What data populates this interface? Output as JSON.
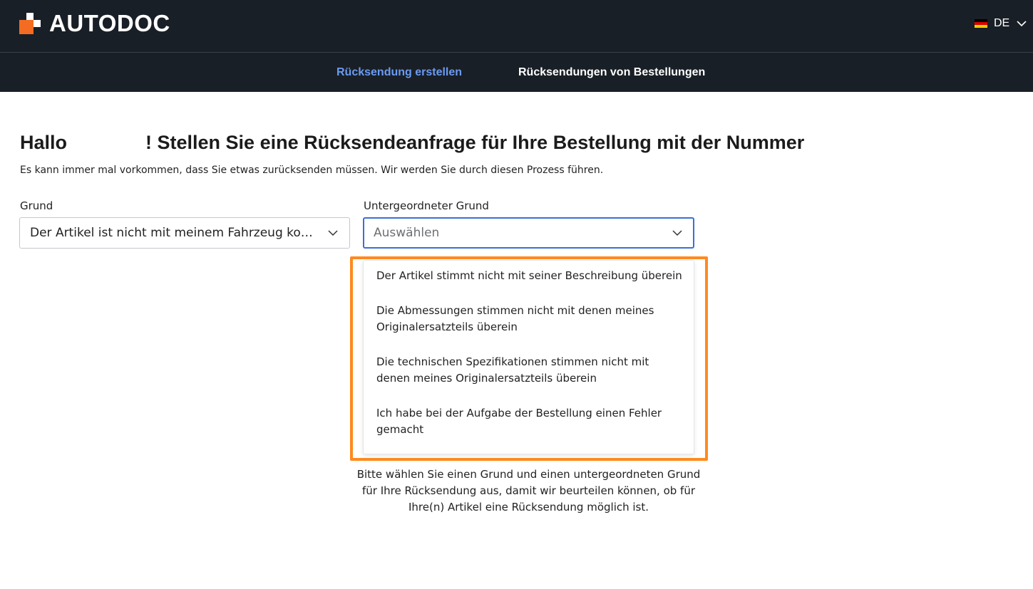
{
  "header": {
    "logo_text": "AUTODOC",
    "brand_color": "#f36c21",
    "language": {
      "label": "DE",
      "flag": "germany-flag-icon"
    }
  },
  "nav": {
    "tabs": [
      {
        "label": "Rücksendung erstellen",
        "active": true,
        "color": "#6b9bf2"
      },
      {
        "label": "Rücksendungen von Bestellungen",
        "active": false,
        "color": "#ffffff"
      }
    ]
  },
  "main": {
    "heading_hello": "Hallo",
    "heading_rest": "! Stellen Sie eine Rücksendeanfrage für Ihre Bestellung mit der Nummer",
    "subtitle": "Es kann immer mal vorkommen, dass Sie etwas zurücksenden müssen. Wir werden Sie durch diesen Prozess führen.",
    "reason": {
      "label": "Grund",
      "value": "Der Artikel ist nicht mit meinem Fahrzeug kompatibel"
    },
    "sub_reason": {
      "label": "Untergeordneter Grund",
      "placeholder": "Auswählen",
      "options": [
        "Der Artikel stimmt nicht mit seiner Beschreibung überein",
        "Die Abmessungen stimmen nicht mit denen meines Originalersatzteils überein",
        "Die technischen Spezifikationen stimmen nicht mit denen meines Originalersatzteils überein",
        "Ich habe bei der Aufgabe der Bestellung einen Fehler gemacht"
      ]
    },
    "hint": "Bitte wählen Sie einen Grund und einen untergeordneten Grund für Ihre Rücksendung aus, damit wir beurteilen können, ob für Ihre(n) Artikel eine Rücksendung möglich ist."
  }
}
